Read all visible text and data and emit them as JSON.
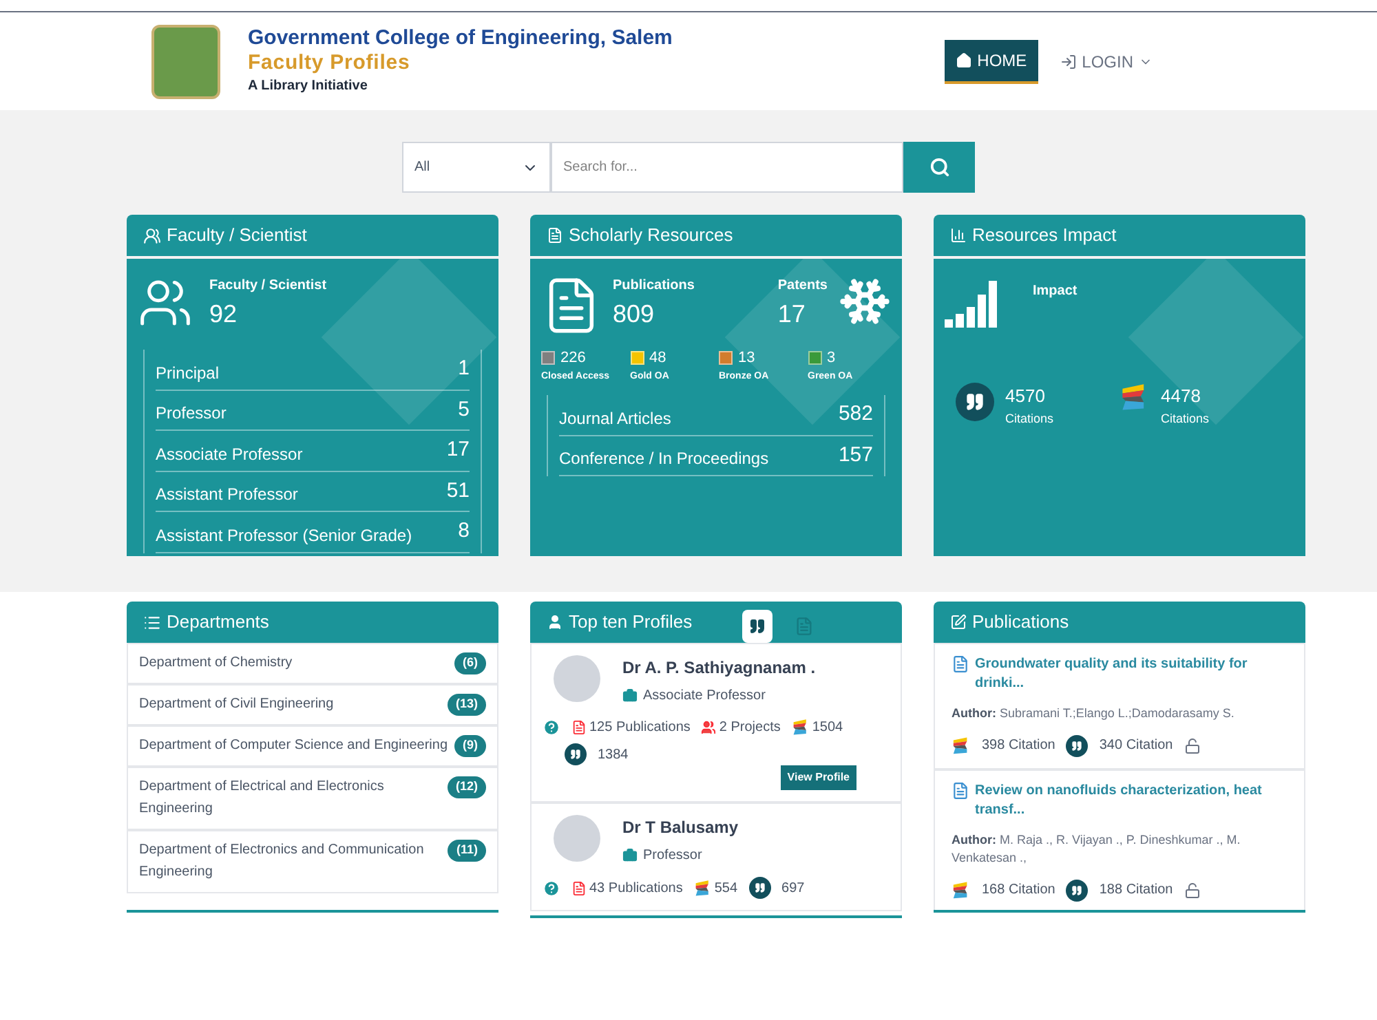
{
  "header": {
    "title": "Government College of Engineering, Salem",
    "subtitle": "Faculty Profiles",
    "tagline": "A Library Initiative",
    "nav": [
      {
        "label": "HOME",
        "kind": "home",
        "selected": true
      },
      {
        "label": "LOGIN",
        "kind": "login",
        "selected": false
      }
    ]
  },
  "search": {
    "scope": "All",
    "placeholder": "Search for..."
  },
  "faculty_card": {
    "title": "Faculty / Scientist",
    "stat_label": "Faculty / Scientist",
    "stat_value": "92",
    "rows": [
      {
        "label": "Principal",
        "value": "1"
      },
      {
        "label": "Professor",
        "value": "5"
      },
      {
        "label": "Associate Professor",
        "value": "17"
      },
      {
        "label": "Assistant Professor",
        "value": "51"
      },
      {
        "label": "Assistant Professor (Senior Grade)",
        "value": "8"
      }
    ]
  },
  "scholarly_card": {
    "title": "Scholarly Resources",
    "publications_label": "Publications",
    "publications_value": "809",
    "patents_label": "Patents",
    "patents_value": "17",
    "access": [
      {
        "value": "226",
        "label": "Closed Access",
        "color": "#808080"
      },
      {
        "value": "48",
        "label": "Gold OA",
        "color": "#f5c400"
      },
      {
        "value": "13",
        "label": "Bronze OA",
        "color": "#d27d2d"
      },
      {
        "value": "3",
        "label": "Green OA",
        "color": "#3a9a3a"
      }
    ],
    "rows": [
      {
        "label": "Journal Articles",
        "value": "582"
      },
      {
        "label": "Conference / In Proceedings",
        "value": "157"
      }
    ]
  },
  "impact_card": {
    "title": "Resources Impact",
    "label": "Impact",
    "citations": [
      {
        "kind": "quote",
        "value": "4570",
        "label": "Citations"
      },
      {
        "kind": "scopus",
        "value": "4478",
        "label": "Citations"
      }
    ]
  },
  "departments": {
    "title": "Departments",
    "items": [
      {
        "name": "Department of Chemistry",
        "count": "(6)"
      },
      {
        "name": "Department of Civil Engineering",
        "count": "(13)"
      },
      {
        "name": "Department of Computer Science and Engineering",
        "count": "(9)"
      },
      {
        "name": "Department of Electrical and Electronics Engineering",
        "count": "(12)"
      },
      {
        "name": "Department of Electronics and Communication Engineering",
        "count": "(11)"
      }
    ]
  },
  "top_profiles": {
    "title": "Top ten Profiles",
    "tabs": [
      {
        "kind": "citations",
        "selected": true
      },
      {
        "kind": "publications",
        "selected": false
      }
    ],
    "profiles": [
      {
        "name": "Dr A. P. Sathiyagnanam .",
        "designation": "Associate Professor",
        "publications": "125 Publications",
        "projects": "2 Projects",
        "scopus": "1504",
        "citations": "1384",
        "action": "View Profile"
      },
      {
        "name": "Dr T Balusamy",
        "designation": "Professor",
        "publications": "43 Publications",
        "scopus": "554",
        "citations": "697"
      }
    ]
  },
  "publications": {
    "title": "Publications",
    "items": [
      {
        "title": "Groundwater quality and its suitability for drinki...",
        "author_label": "Author:",
        "authors": "Subramani T.;Elango L.;Damodarasamy S.",
        "scopus": "398 Citation",
        "google": "340 Citation"
      },
      {
        "title": "Review on nanofluids characterization, heat transf...",
        "author_label": "Author:",
        "authors": "M. Raja ., R. Vijayan ., P. Dineshkumar ., M. Venkatesan .,",
        "scopus": "168 Citation",
        "google": "188 Citation"
      }
    ]
  }
}
